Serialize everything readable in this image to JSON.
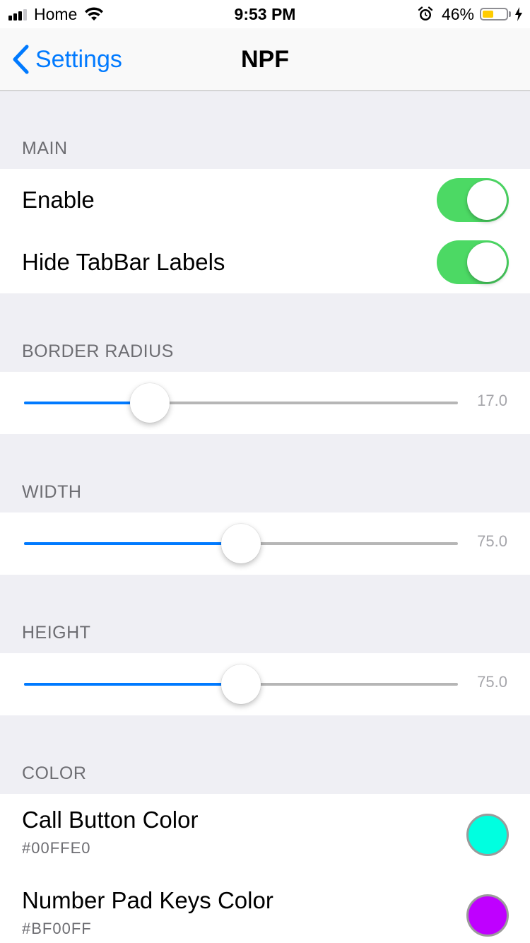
{
  "status_bar": {
    "carrier": "Home",
    "time": "9:53 PM",
    "battery_percent": "46%",
    "battery_level": 0.46,
    "icons": [
      "signal-icon",
      "wifi-icon",
      "alarm-icon",
      "battery-icon",
      "charging-bolt-icon"
    ]
  },
  "nav": {
    "back_label": "Settings",
    "title": "NPF"
  },
  "main": {
    "header": "MAIN",
    "toggles": [
      {
        "label": "Enable",
        "on": true
      },
      {
        "label": "Hide TabBar Labels",
        "on": true
      }
    ]
  },
  "border_radius": {
    "header": "BORDER RADIUS",
    "value": "17.0",
    "fraction": 0.29
  },
  "width": {
    "header": "WIDTH",
    "value": "75.0",
    "fraction": 0.5
  },
  "height": {
    "header": "HEIGHT",
    "value": "75.0",
    "fraction": 0.5
  },
  "color": {
    "header": "COLOR",
    "items": [
      {
        "title": "Call Button Color",
        "hex": "#00FFE0",
        "swatch": "#00FFE0"
      },
      {
        "title": "Number Pad Keys Color",
        "hex": "#BF00FF",
        "swatch": "#BF00FF"
      }
    ]
  },
  "colors": {
    "accent": "#007aff",
    "switch_on": "#4cd964",
    "background": "#efeff4"
  }
}
